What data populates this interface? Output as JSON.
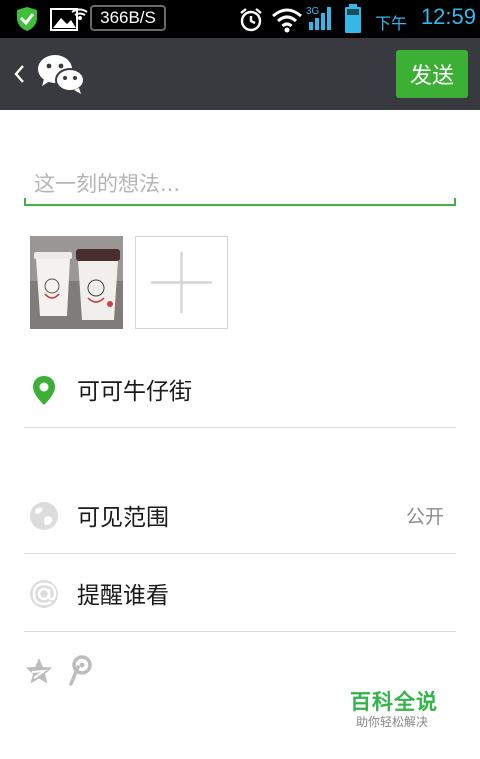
{
  "status_bar": {
    "net_speed": "366B/S",
    "ampm": "下午",
    "time": "12:59",
    "accent": "#35b7ea"
  },
  "header": {
    "back_icon": "chevron-left-icon",
    "app_icon": "wechat-logo-icon",
    "send_label": "发送",
    "brand_color": "#3cb034",
    "background": "#393a3f"
  },
  "composer": {
    "placeholder": "这一刻的想法...",
    "value": ""
  },
  "photos": {
    "add_icon": "plus-icon"
  },
  "location": {
    "icon": "location-pin-icon",
    "label": "可可牛仔街"
  },
  "visibility": {
    "icon": "globe-icon",
    "label": "可见范围",
    "value": "公开"
  },
  "remind": {
    "icon": "at-sign-icon",
    "label": "提醒谁看"
  },
  "share": {
    "icons": [
      "qzone-star-icon",
      "tencent-weibo-icon"
    ]
  },
  "watermark": {
    "title": "百科全说",
    "subtitle": "助你轻松解决"
  }
}
